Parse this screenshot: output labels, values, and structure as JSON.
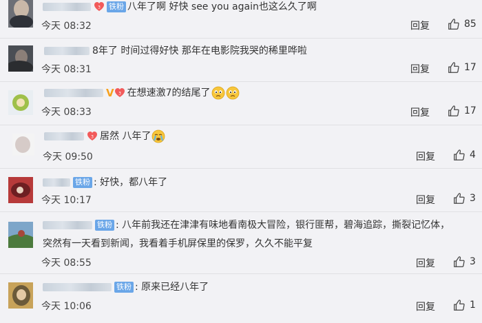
{
  "reply_label": "回复",
  "comments": [
    {
      "text": "八年了啊 好快 see you again也这么久了啊",
      "time": "今天 08:32",
      "likes": "85"
    },
    {
      "prefix": "8年了",
      "text": "时间过得好快 那年在电影院我哭的稀里哗啦",
      "time": "今天 08:31",
      "likes": "17"
    },
    {
      "text": "在想速激7的结尾了",
      "time": "今天 08:33",
      "likes": "17"
    },
    {
      "text": "居然 八年了",
      "time": "今天 09:50",
      "likes": "4"
    },
    {
      "badge": "铁粉",
      "text": "好快，都八年了",
      "time": "今天 10:17",
      "likes": "3"
    },
    {
      "badge": "铁粉",
      "text": "八年前我还在津津有味地看南极大冒险，银行匪帮，碧海追踪，撕裂记忆体，",
      "text2": "突然有一天看到新闻，我看着手机屏保里的保罗，久久不能平复",
      "time": "今天 08:55",
      "likes": "3"
    },
    {
      "badge": "铁粉",
      "text": "原来已经八年了",
      "time": "今天 10:06",
      "likes": "1"
    }
  ]
}
